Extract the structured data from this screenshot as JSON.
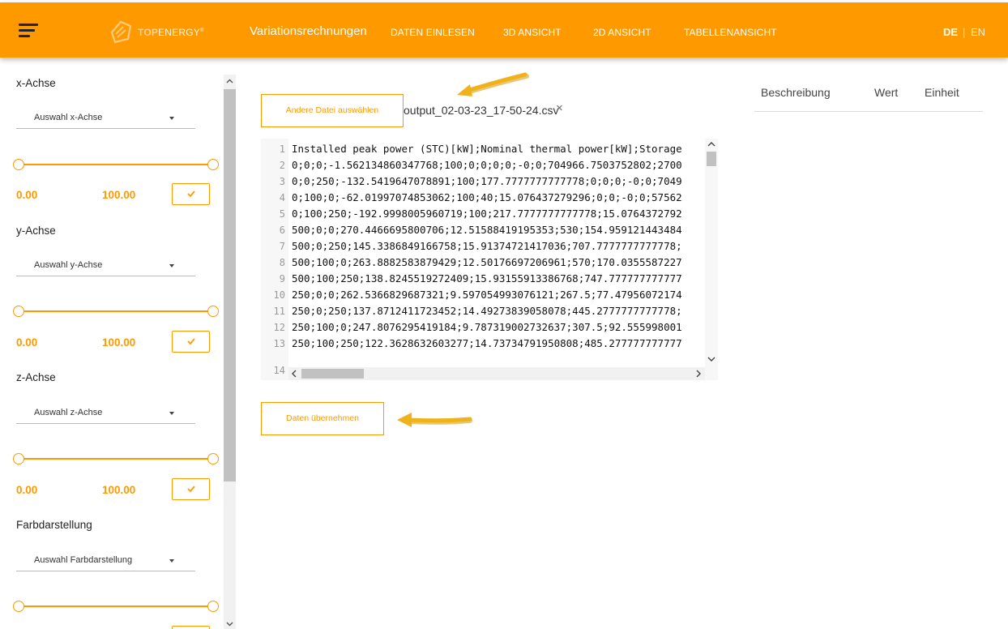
{
  "header": {
    "logo": {
      "brand_prefix": "TOP",
      "brand_suffix": "ENERGY",
      "registered": "®"
    },
    "title": "Variationsrechnungen",
    "nav": [
      "DATEN EINLESEN",
      "3D ANSICHT",
      "2D ANSICHT",
      "TABELLENANSICHT"
    ],
    "languages": {
      "active": "DE",
      "separator": "|",
      "other": "EN"
    }
  },
  "sidebar": {
    "sections": [
      {
        "label": "x-Achse",
        "select": "Auswahl x-Achse",
        "min": "0.00",
        "max": "100.00"
      },
      {
        "label": "y-Achse",
        "select": "Auswahl y-Achse",
        "min": "0.00",
        "max": "100.00"
      },
      {
        "label": "z-Achse",
        "select": "Auswahl z-Achse",
        "min": "0.00",
        "max": "100.00"
      },
      {
        "label": "Farbdarstellung",
        "select": "Auswahl Farbdarstellung"
      }
    ]
  },
  "main": {
    "choose_file_button": "Andere Datei auswählen",
    "filename": "output_02-03-23_17-50-24.csv",
    "remove_file_icon": "×",
    "apply_button": "Daten übernehmen",
    "editor": {
      "line_numbers": [
        "1",
        "2",
        "3",
        "4",
        "5",
        "6",
        "7",
        "8",
        "9",
        "10",
        "11",
        "12",
        "13",
        "14"
      ],
      "lines": [
        "Installed peak power (STC)[kW];Nominal thermal power[kW];Storage",
        "0;0;0;-1.562134860347768;100;0;0;0;0;-0;0;704966.7503752802;2700",
        "0;0;250;-132.5419647078891;100;177.7777777777778;0;0;0;-0;0;7049",
        "0;100;0;-62.01997074853062;100;40;15.076437279296;0;0;-0;0;57562",
        "0;100;250;-192.9998005960719;100;217.7777777777778;15.0764372792",
        "500;0;0;270.4466695800706;12.51588419195353;530;154.959121443484",
        "500;0;250;145.3386849166758;15.91374721417036;707.7777777777778;",
        "500;100;0;263.8882583879429;12.50176697206961;570;170.0355587227",
        "500;100;250;138.8245519272409;15.93155913386768;747.777777777777",
        "250;0;0;262.5366829687321;9.597054993076121;267.5;77.47956072174",
        "250;0;250;137.8712411723452;14.49273839058078;445.2777777777778;",
        "250;100;0;247.8076295419184;9.787319002732637;307.5;92.555998001",
        "250;100;250;122.3628632603277;14.73734791950808;485.277777777777"
      ]
    },
    "table": {
      "headers": [
        "Beschreibung",
        "Wert",
        "Einheit"
      ]
    }
  },
  "colors": {
    "accent": "#ff9900",
    "arrow": "#f0b21a"
  }
}
